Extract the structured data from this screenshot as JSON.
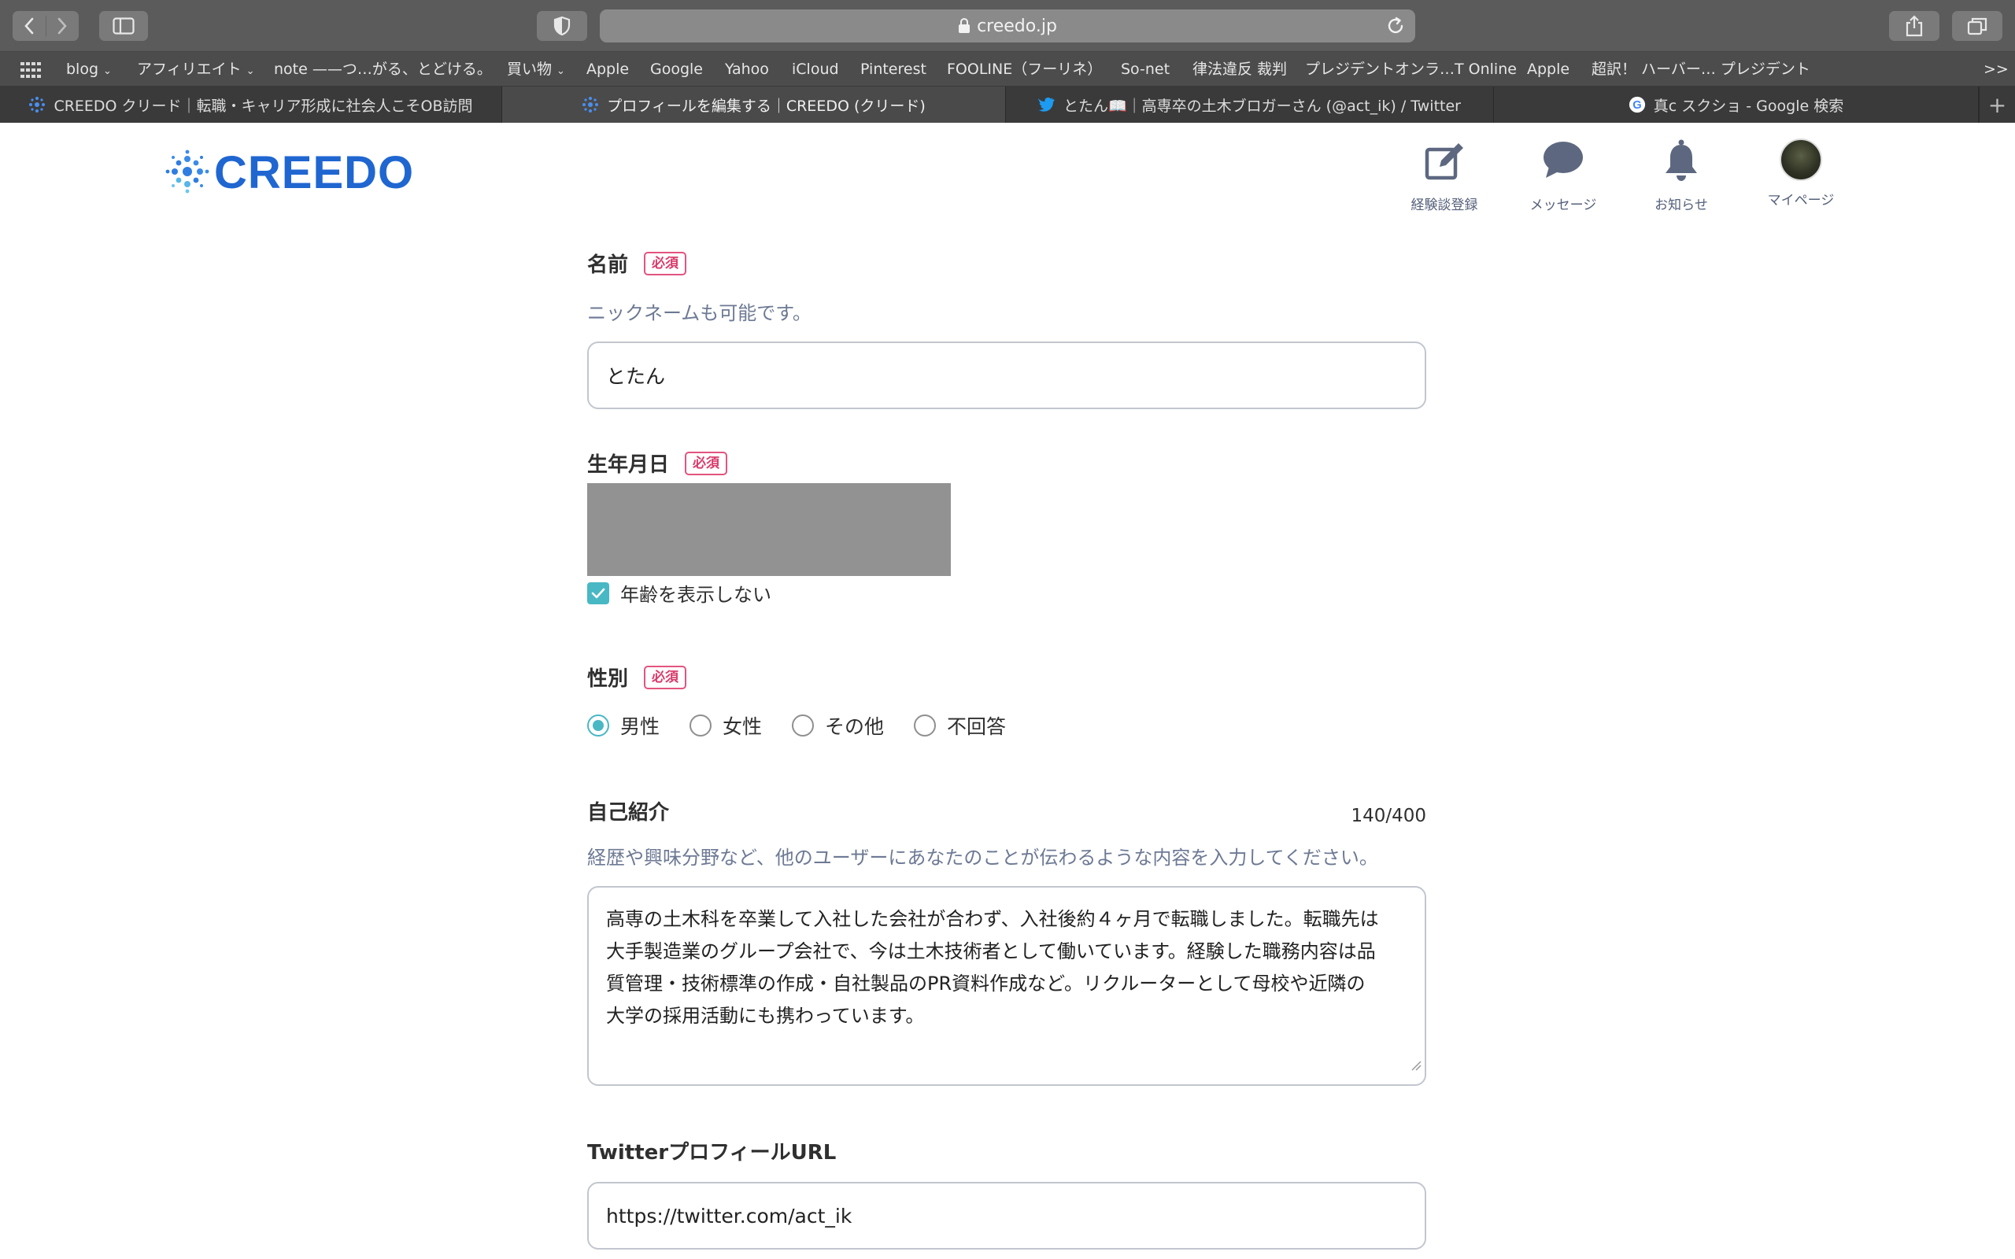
{
  "browser": {
    "url": "creedo.jp",
    "bookmarks": [
      {
        "label": "blog",
        "dropdown": true
      },
      {
        "label": "アフィリエイト",
        "dropdown": true
      },
      {
        "label": "note ——つ…がる、とどける。",
        "dropdown": false
      },
      {
        "label": "買い物",
        "dropdown": true
      },
      {
        "label": "Apple",
        "dropdown": false
      },
      {
        "label": "Google",
        "dropdown": false
      },
      {
        "label": "Yahoo",
        "dropdown": false
      },
      {
        "label": "iCloud",
        "dropdown": false
      },
      {
        "label": "Pinterest",
        "dropdown": false
      },
      {
        "label": "FOOLINE（フーリネ）",
        "dropdown": false
      },
      {
        "label": "So-net",
        "dropdown": false
      },
      {
        "label": "律法違反 裁判",
        "dropdown": false
      },
      {
        "label": "プレジデントオンラ…T Online",
        "dropdown": false
      },
      {
        "label": "Apple",
        "dropdown": false
      },
      {
        "label": "超訳！ ハーバー… プレジデント",
        "dropdown": false
      }
    ],
    "more": ">>",
    "tabs": [
      {
        "label": "CREEDO クリード｜転職・キャリア形成に社会人こそOB訪問",
        "active": false,
        "favicon": "creedo-icon"
      },
      {
        "label": "プロフィールを編集する｜CREEDO (クリード)",
        "active": true,
        "favicon": "creedo-icon"
      },
      {
        "label": "とたん📖｜高専卒の土木ブロガーさん (@act_ik) / Twitter",
        "active": false,
        "favicon": "twitter-icon"
      },
      {
        "label": "真c スクショ - Google 検索",
        "active": false,
        "favicon": "google-icon"
      }
    ]
  },
  "header": {
    "logo": "CREEDO",
    "nav": [
      {
        "label": "経験談登録",
        "icon": "edit-icon"
      },
      {
        "label": "メッセージ",
        "icon": "chat-bubble-icon"
      },
      {
        "label": "お知らせ",
        "icon": "bell-icon"
      },
      {
        "label": "マイページ",
        "icon": "avatar"
      }
    ]
  },
  "form": {
    "required_badge": "必須",
    "name": {
      "label": "名前",
      "hint": "ニックネームも可能です。",
      "value": "とたん"
    },
    "birthday": {
      "label": "生年月日",
      "hide_age_label": "年齢を表示しない",
      "hide_age_checked": true
    },
    "gender": {
      "label": "性別",
      "options": [
        "男性",
        "女性",
        "その他",
        "不回答"
      ],
      "selected": "男性"
    },
    "bio": {
      "label": "自己紹介",
      "counter": "140/400",
      "hint": "経歴や興味分野など、他のユーザーにあなたのことが伝わるような内容を入力してください。",
      "lines": [
        "高専の土木科を卒業して入社した会社が合わず、入社後約４ヶ月で転職しました。転職先は",
        "大手製造業のグループ会社で、今は土木技術者として働いています。経験した職務内容は品",
        "質管理・技術標準の作成・自社製品のPR資料作成など。リクルーターとして母校や近隣の",
        "大学の採用活動にも携わっています。"
      ]
    },
    "twitter": {
      "label": "TwitterプロフィールURL",
      "value": "https://twitter.com/act_ik"
    }
  }
}
